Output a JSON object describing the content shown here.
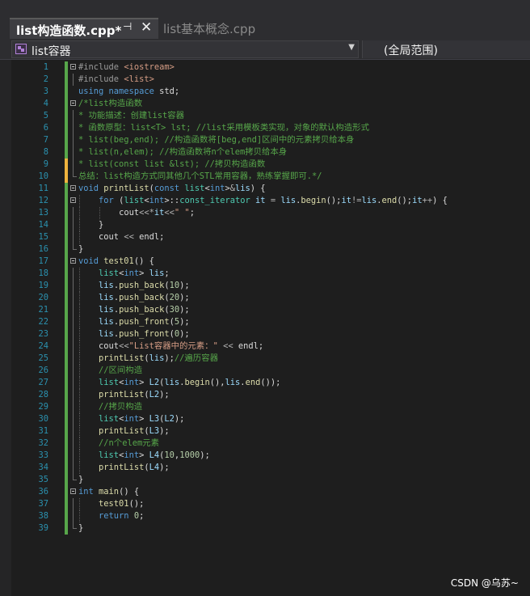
{
  "tabs": {
    "active": {
      "title": "list构造函数.cpp*",
      "pin_icon": "pin-icon",
      "close_icon": "close-icon"
    },
    "inactive": {
      "title": "list基本概念.cpp"
    }
  },
  "navbar": {
    "scope_left": "list容器",
    "scope_right": "(全局范围)",
    "class_icon": "class-icon",
    "dropdown_icon": "chevron-down-icon"
  },
  "colors": {
    "keyword": "#569cd6",
    "comment": "#57a64a",
    "string": "#d69d85",
    "type": "#4ec9b0",
    "line_number": "#2b91af",
    "change_bar_saved": "#57a64a",
    "change_bar_unsaved": "#efb33d"
  },
  "code": {
    "lines": [
      {
        "n": "1",
        "tokens": [
          [
            "pp",
            "#include "
          ],
          [
            "str",
            "<iostream>"
          ]
        ]
      },
      {
        "n": "2",
        "tokens": [
          [
            "pp",
            "#include "
          ],
          [
            "str",
            "<list>"
          ]
        ]
      },
      {
        "n": "3",
        "tokens": [
          [
            "kw",
            "using namespace "
          ],
          [
            "pl",
            "std;"
          ]
        ]
      },
      {
        "n": "4",
        "tokens": [
          [
            "cm",
            "/*list构造函数"
          ]
        ]
      },
      {
        "n": "5",
        "tokens": [
          [
            "cm",
            "* 功能描述：创建list容器"
          ]
        ]
      },
      {
        "n": "6",
        "tokens": [
          [
            "cm",
            "* 函数原型：list<T> lst; //list采用模板类实现，对象的默认构造形式"
          ]
        ]
      },
      {
        "n": "7",
        "tokens": [
          [
            "cm",
            "* list(beg,end); //构造函数将[beg,end]区间中的元素拷贝给本身"
          ]
        ]
      },
      {
        "n": "8",
        "tokens": [
          [
            "cm",
            "* list(n,elem); //构造函数将n个elem拷贝给本身"
          ]
        ]
      },
      {
        "n": "9",
        "tokens": [
          [
            "cm",
            "* list(const list &lst); //拷贝构造函数"
          ]
        ]
      },
      {
        "n": "10",
        "tokens": [
          [
            "cm",
            "总结：list构造方式同其他几个STL常用容器，熟练掌握即可.*/"
          ]
        ]
      },
      {
        "n": "11",
        "tokens": [
          [
            "kw",
            "void "
          ],
          [
            "fn",
            "printList"
          ],
          [
            "pl",
            "("
          ],
          [
            "kw",
            "const "
          ],
          [
            "type",
            "list"
          ],
          [
            "pl",
            "<"
          ],
          [
            "kw",
            "int"
          ],
          [
            "pl",
            ">"
          ],
          [
            "op",
            "&"
          ],
          [
            "var",
            "lis"
          ],
          [
            "pl",
            ") {"
          ]
        ]
      },
      {
        "n": "12",
        "tokens": [
          [
            "kw",
            "for "
          ],
          [
            "pl",
            "("
          ],
          [
            "type",
            "list"
          ],
          [
            "pl",
            "<"
          ],
          [
            "kw",
            "int"
          ],
          [
            "pl",
            ">::"
          ],
          [
            "type",
            "const_iterator "
          ],
          [
            "var",
            "it "
          ],
          [
            "op",
            "= "
          ],
          [
            "var",
            "lis"
          ],
          [
            "pl",
            "."
          ],
          [
            "fn",
            "begin"
          ],
          [
            "pl",
            "();"
          ],
          [
            "var",
            "it"
          ],
          [
            "op",
            "!="
          ],
          [
            "var",
            "lis"
          ],
          [
            "pl",
            "."
          ],
          [
            "fn",
            "end"
          ],
          [
            "pl",
            "();"
          ],
          [
            "var",
            "it"
          ],
          [
            "op",
            "++"
          ],
          [
            "pl",
            ") {"
          ]
        ]
      },
      {
        "n": "13",
        "tokens": [
          [
            "pl",
            "cout"
          ],
          [
            "op",
            "<<*"
          ],
          [
            "var",
            "it"
          ],
          [
            "op",
            "<<"
          ],
          [
            "str",
            "\" \""
          ],
          [
            "pl",
            ";"
          ]
        ]
      },
      {
        "n": "14",
        "tokens": [
          [
            "pl",
            "}"
          ]
        ]
      },
      {
        "n": "15",
        "tokens": [
          [
            "pl",
            "cout "
          ],
          [
            "op",
            "<< "
          ],
          [
            "pl",
            "endl;"
          ]
        ]
      },
      {
        "n": "16",
        "tokens": [
          [
            "pl",
            "}"
          ]
        ]
      },
      {
        "n": "17",
        "tokens": [
          [
            "kw",
            "void "
          ],
          [
            "fn",
            "test01"
          ],
          [
            "pl",
            "() {"
          ]
        ]
      },
      {
        "n": "18",
        "tokens": [
          [
            "type",
            "list"
          ],
          [
            "pl",
            "<"
          ],
          [
            "kw",
            "int"
          ],
          [
            "pl",
            "> "
          ],
          [
            "var",
            "lis"
          ],
          [
            "pl",
            ";"
          ]
        ]
      },
      {
        "n": "19",
        "tokens": [
          [
            "var",
            "lis"
          ],
          [
            "pl",
            "."
          ],
          [
            "fn",
            "push_back"
          ],
          [
            "pl",
            "("
          ],
          [
            "num",
            "10"
          ],
          [
            "pl",
            ");"
          ]
        ]
      },
      {
        "n": "20",
        "tokens": [
          [
            "var",
            "lis"
          ],
          [
            "pl",
            "."
          ],
          [
            "fn",
            "push_back"
          ],
          [
            "pl",
            "("
          ],
          [
            "num",
            "20"
          ],
          [
            "pl",
            ");"
          ]
        ]
      },
      {
        "n": "21",
        "tokens": [
          [
            "var",
            "lis"
          ],
          [
            "pl",
            "."
          ],
          [
            "fn",
            "push_back"
          ],
          [
            "pl",
            "("
          ],
          [
            "num",
            "30"
          ],
          [
            "pl",
            ");"
          ]
        ]
      },
      {
        "n": "22",
        "tokens": [
          [
            "var",
            "lis"
          ],
          [
            "pl",
            "."
          ],
          [
            "fn",
            "push_front"
          ],
          [
            "pl",
            "("
          ],
          [
            "num",
            "5"
          ],
          [
            "pl",
            ");"
          ]
        ]
      },
      {
        "n": "23",
        "tokens": [
          [
            "var",
            "lis"
          ],
          [
            "pl",
            "."
          ],
          [
            "fn",
            "push_front"
          ],
          [
            "pl",
            "("
          ],
          [
            "num",
            "0"
          ],
          [
            "pl",
            ");"
          ]
        ]
      },
      {
        "n": "24",
        "tokens": [
          [
            "pl",
            "cout"
          ],
          [
            "op",
            "<<"
          ],
          [
            "str",
            "\"List容器中的元素：\" "
          ],
          [
            "op",
            "<< "
          ],
          [
            "pl",
            "endl;"
          ]
        ]
      },
      {
        "n": "25",
        "tokens": [
          [
            "fn",
            "printList"
          ],
          [
            "pl",
            "("
          ],
          [
            "var",
            "lis"
          ],
          [
            "pl",
            ");"
          ],
          [
            "cm",
            "//遍历容器"
          ]
        ]
      },
      {
        "n": "26",
        "tokens": [
          [
            "cm",
            "//区间构造"
          ]
        ]
      },
      {
        "n": "27",
        "tokens": [
          [
            "type",
            "list"
          ],
          [
            "pl",
            "<"
          ],
          [
            "kw",
            "int"
          ],
          [
            "pl",
            "> "
          ],
          [
            "var",
            "L2"
          ],
          [
            "pl",
            "("
          ],
          [
            "var",
            "lis"
          ],
          [
            "pl",
            "."
          ],
          [
            "fn",
            "begin"
          ],
          [
            "pl",
            "(),"
          ],
          [
            "var",
            "lis"
          ],
          [
            "pl",
            "."
          ],
          [
            "fn",
            "end"
          ],
          [
            "pl",
            "());"
          ]
        ]
      },
      {
        "n": "28",
        "tokens": [
          [
            "fn",
            "printList"
          ],
          [
            "pl",
            "("
          ],
          [
            "var",
            "L2"
          ],
          [
            "pl",
            ");"
          ]
        ]
      },
      {
        "n": "29",
        "tokens": [
          [
            "cm",
            "//拷贝构造"
          ]
        ]
      },
      {
        "n": "30",
        "tokens": [
          [
            "type",
            "list"
          ],
          [
            "pl",
            "<"
          ],
          [
            "kw",
            "int"
          ],
          [
            "pl",
            "> "
          ],
          [
            "var",
            "L3"
          ],
          [
            "pl",
            "("
          ],
          [
            "var",
            "L2"
          ],
          [
            "pl",
            ");"
          ]
        ]
      },
      {
        "n": "31",
        "tokens": [
          [
            "fn",
            "printList"
          ],
          [
            "pl",
            "("
          ],
          [
            "var",
            "L3"
          ],
          [
            "pl",
            ");"
          ]
        ]
      },
      {
        "n": "32",
        "tokens": [
          [
            "cm",
            "//n个elem元素"
          ]
        ]
      },
      {
        "n": "33",
        "tokens": [
          [
            "type",
            "list"
          ],
          [
            "pl",
            "<"
          ],
          [
            "kw",
            "int"
          ],
          [
            "pl",
            "> "
          ],
          [
            "var",
            "L4"
          ],
          [
            "pl",
            "("
          ],
          [
            "num",
            "10"
          ],
          [
            "pl",
            ","
          ],
          [
            "num",
            "1000"
          ],
          [
            "pl",
            ");"
          ]
        ]
      },
      {
        "n": "34",
        "tokens": [
          [
            "fn",
            "printList"
          ],
          [
            "pl",
            "("
          ],
          [
            "var",
            "L4"
          ],
          [
            "pl",
            ");"
          ]
        ]
      },
      {
        "n": "35",
        "tokens": [
          [
            "pl",
            "}"
          ]
        ]
      },
      {
        "n": "36",
        "tokens": [
          [
            "kw",
            "int "
          ],
          [
            "fn",
            "main"
          ],
          [
            "pl",
            "() {"
          ]
        ]
      },
      {
        "n": "37",
        "tokens": [
          [
            "fn",
            "test01"
          ],
          [
            "pl",
            "();"
          ]
        ]
      },
      {
        "n": "38",
        "tokens": [
          [
            "kw",
            "return "
          ],
          [
            "num",
            "0"
          ],
          [
            "pl",
            ";"
          ]
        ]
      },
      {
        "n": "39",
        "tokens": [
          [
            "pl",
            "}"
          ]
        ]
      }
    ]
  },
  "watermark": "CSDN @乌苏~"
}
